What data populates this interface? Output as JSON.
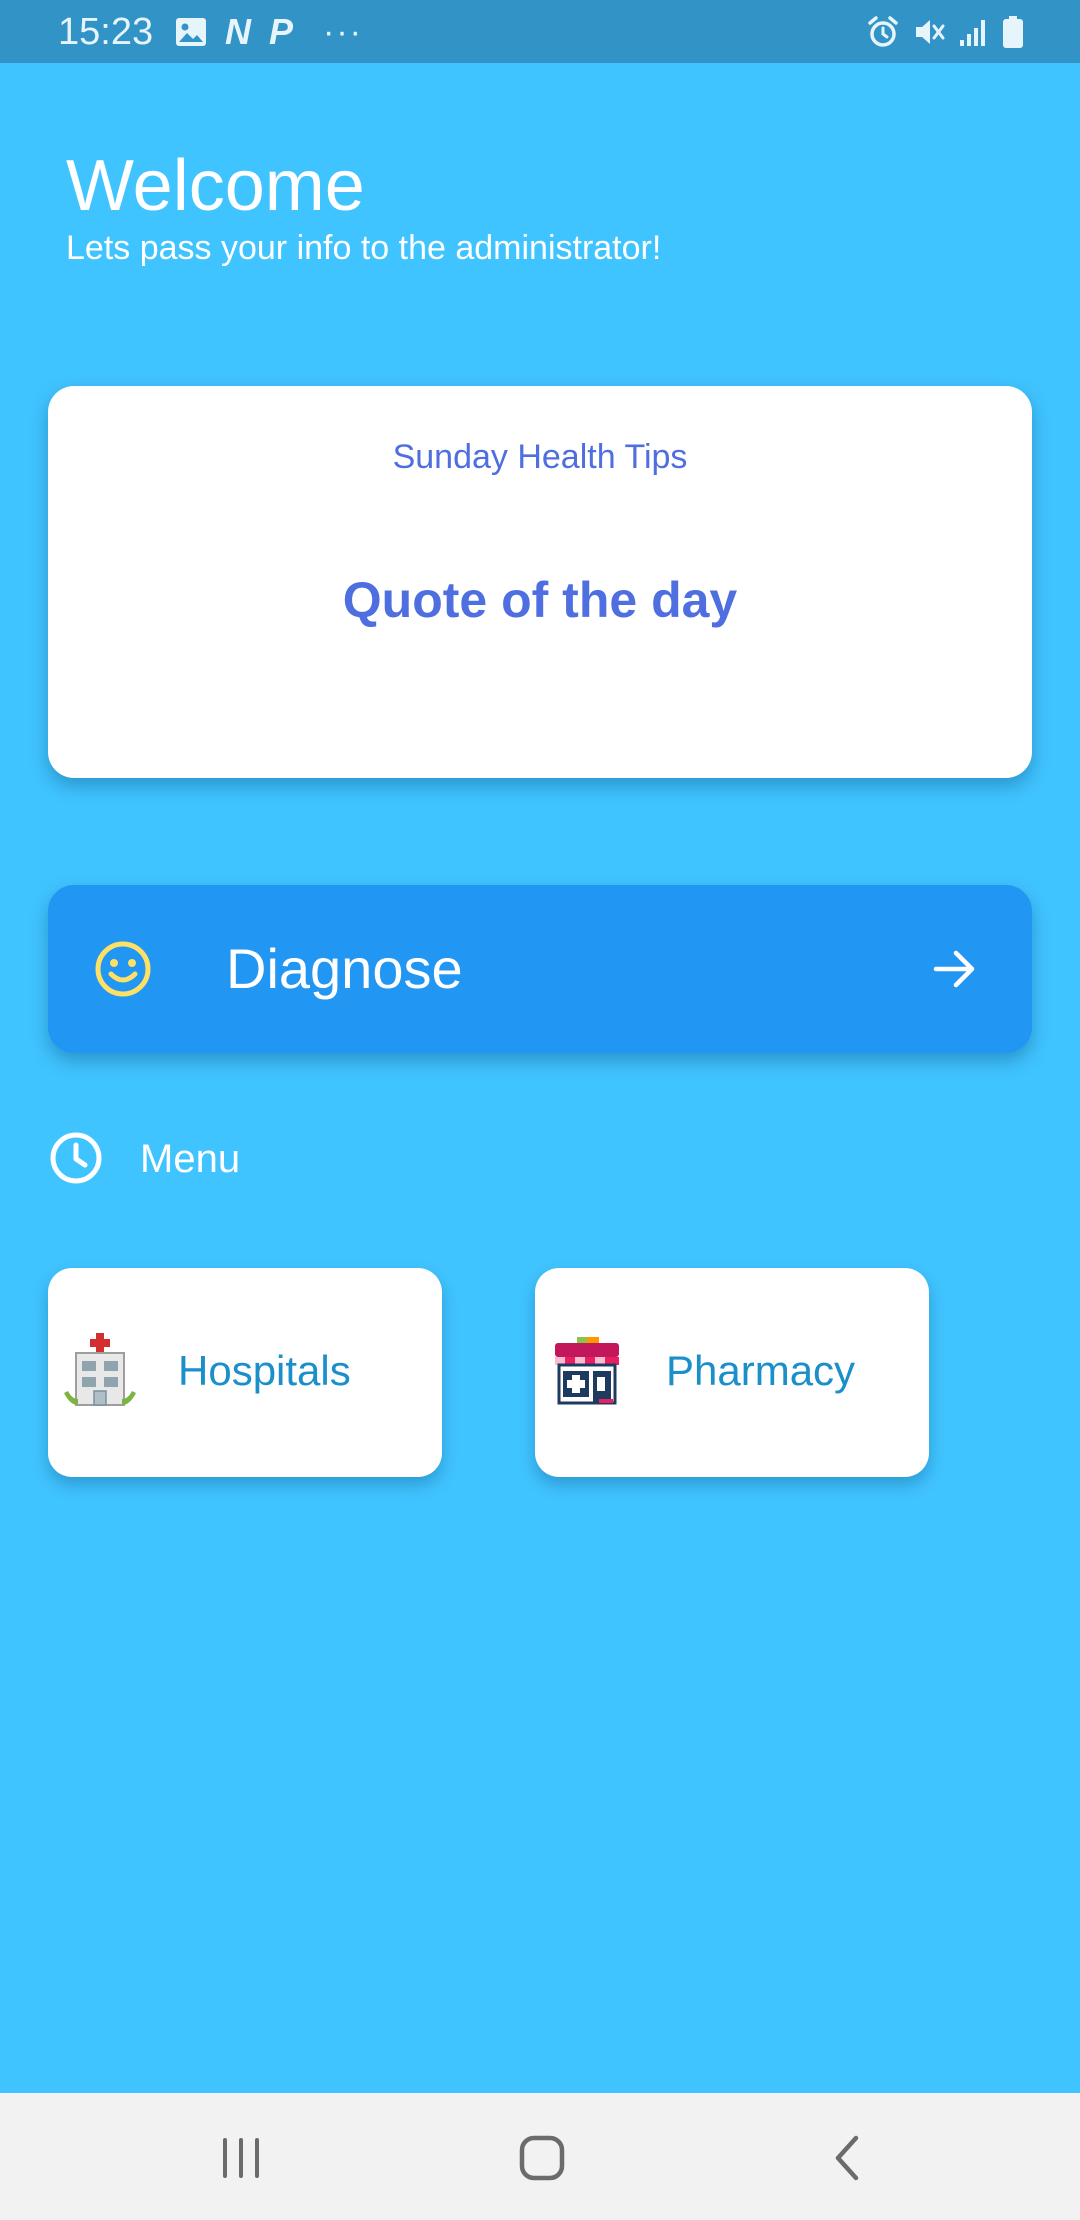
{
  "status_bar": {
    "time": "15:23",
    "left_icons": [
      "image-icon",
      "n-notification-icon",
      "p-notification-icon",
      "more-dots-icon"
    ],
    "n_letter": "N",
    "p_letter": "P",
    "dots": "···",
    "right_icons": [
      "alarm-icon",
      "mute-icon",
      "signal-icon",
      "battery-icon"
    ]
  },
  "header": {
    "title": "Welcome",
    "subtitle": "Lets pass your info to the administrator!"
  },
  "quote_card": {
    "subtitle": "Sunday Health Tips",
    "title": "Quote of the day"
  },
  "diagnose": {
    "label": "Diagnose",
    "icon": "smiley-icon",
    "arrow_icon": "arrow-right-icon"
  },
  "menu": {
    "label": "Menu",
    "icon": "clock-icon",
    "tiles": [
      {
        "label": "Hospitals",
        "icon": "hospital-icon"
      },
      {
        "label": "Pharmacy",
        "icon": "pharmacy-icon"
      }
    ]
  },
  "nav_bar": {
    "buttons": [
      "recent-apps-icon",
      "home-icon",
      "back-icon"
    ]
  },
  "colors": {
    "background": "#40c4ff",
    "status_bar": "#3293c6",
    "card_text": "#4f6fe0",
    "diagnose_button": "#2196f3",
    "smiley": "#ffe066",
    "tile_text": "#1a8fc9",
    "nav_bar": "#f2f2f2"
  }
}
